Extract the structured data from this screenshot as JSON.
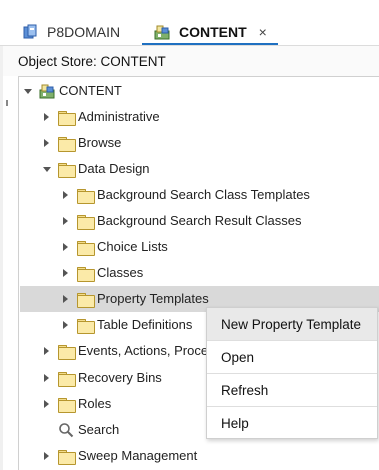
{
  "tabs": [
    {
      "label": "P8DOMAIN",
      "icon": "domain-icon",
      "active": false
    },
    {
      "label": "CONTENT",
      "icon": "object-store-icon",
      "active": true,
      "close": "×"
    }
  ],
  "object_store_label": "Object Store: CONTENT",
  "tree": {
    "root": "CONTENT",
    "items": [
      {
        "label": "Administrative"
      },
      {
        "label": "Browse"
      },
      {
        "label": "Data Design"
      },
      {
        "label": "Background Search Class Templates"
      },
      {
        "label": "Background Search Result Classes"
      },
      {
        "label": "Choice Lists"
      },
      {
        "label": "Classes"
      },
      {
        "label": "Property Templates"
      },
      {
        "label": "Table Definitions"
      },
      {
        "label": "Events, Actions, Proces"
      },
      {
        "label": "Recovery Bins"
      },
      {
        "label": "Roles"
      },
      {
        "label": "Search"
      },
      {
        "label": "Sweep Management"
      }
    ]
  },
  "context_menu": {
    "items": [
      {
        "label": "New Property Template"
      },
      {
        "label": "Open"
      },
      {
        "label": "Refresh"
      },
      {
        "label": "Help"
      }
    ]
  },
  "colors": {
    "active_tab_underline": "#1f70c1",
    "selected_row": "#d9d9d9",
    "menu_hover": "#e9e9e9",
    "folder_fill": "#fbeaa8"
  }
}
